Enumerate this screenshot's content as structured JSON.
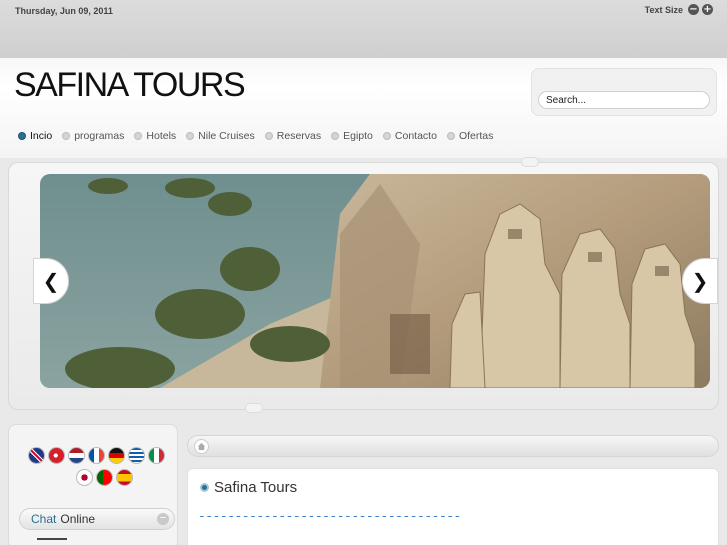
{
  "topbar": {
    "date": "Thursday, Jun 09, 2011",
    "text_size_label": "Text Size",
    "decrease_symbol": "−",
    "increase_symbol": "+"
  },
  "header": {
    "site_title": "SAFINA TOURS",
    "search_placeholder": "Search..."
  },
  "nav": {
    "items": [
      {
        "label": "Incio",
        "active": true
      },
      {
        "label": "programas",
        "active": false
      },
      {
        "label": "Hotels",
        "active": false
      },
      {
        "label": "Nile Cruises",
        "active": false
      },
      {
        "label": "Reservas",
        "active": false
      },
      {
        "label": "Egipto",
        "active": false
      },
      {
        "label": "Contacto",
        "active": false
      },
      {
        "label": "Ofertas",
        "active": false
      }
    ]
  },
  "slider": {
    "prev_symbol": "❮",
    "next_symbol": "❯"
  },
  "languages": {
    "row1": [
      "english-flag",
      "turkish-flag",
      "dutch-flag",
      "french-flag",
      "german-flag",
      "greek-flag",
      "italian-flag"
    ],
    "row2": [
      "japanese-flag",
      "portuguese-flag",
      "spanish-flag"
    ]
  },
  "chat": {
    "word1": "Chat",
    "word2": "Online",
    "toggle_symbol": "−"
  },
  "content": {
    "title": "Safina Tours",
    "dashes": "------------------------------------"
  },
  "colors": {
    "accent": "#2b6f92",
    "link_blue": "#3a7fc8"
  }
}
